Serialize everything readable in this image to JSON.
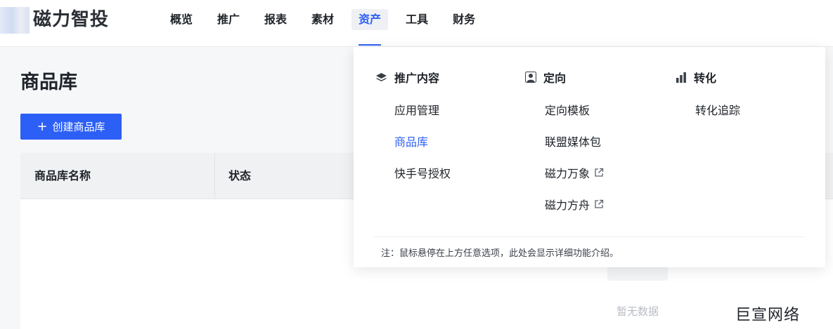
{
  "brand": {
    "name": "磁力智投"
  },
  "nav": {
    "items": [
      {
        "label": "概览"
      },
      {
        "label": "推广"
      },
      {
        "label": "报表"
      },
      {
        "label": "素材"
      },
      {
        "label": "资产",
        "active": true
      },
      {
        "label": "工具"
      },
      {
        "label": "财务"
      }
    ]
  },
  "page": {
    "title": "商品库",
    "create_button": "创建商品库",
    "table": {
      "columns": [
        "商品库名称",
        "状态"
      ],
      "empty_text": "暂无数据"
    }
  },
  "dropdown": {
    "columns": [
      {
        "heading": "推广内容",
        "icon": "layers-icon",
        "items": [
          {
            "label": "应用管理"
          },
          {
            "label": "商品库",
            "selected": true
          },
          {
            "label": "快手号授权"
          }
        ]
      },
      {
        "heading": "定向",
        "icon": "user-icon",
        "items": [
          {
            "label": "定向模板"
          },
          {
            "label": "联盟媒体包"
          },
          {
            "label": "磁力万象",
            "external": true
          },
          {
            "label": "磁力方舟",
            "external": true
          }
        ]
      },
      {
        "heading": "转化",
        "icon": "bar-chart-icon",
        "items": [
          {
            "label": "转化追踪"
          }
        ]
      }
    ],
    "note": "注：鼠标悬停在上方任意选项，此处会显示详细功能介绍。"
  },
  "watermark": "巨宣网络",
  "colors": {
    "accent": "#2c5ff6",
    "text": "#1f2329",
    "muted": "#b8bcc4"
  }
}
